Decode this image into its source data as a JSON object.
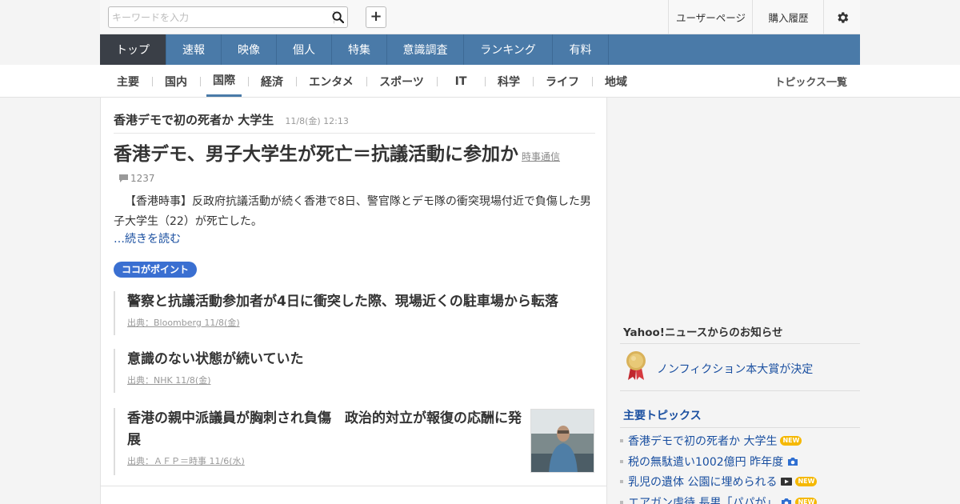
{
  "header": {
    "search_placeholder": "キーワードを入力",
    "user_page": "ユーザーページ",
    "purchase_history": "購入履歴",
    "add_label": "+"
  },
  "main_nav": [
    "トップ",
    "速報",
    "映像",
    "個人",
    "特集",
    "意識調査",
    "ランキング",
    "有料"
  ],
  "sub_nav": {
    "items": [
      "主要",
      "国内",
      "国際",
      "経済",
      "エンタメ",
      "スポーツ",
      "IT",
      "科学",
      "ライフ",
      "地域"
    ],
    "active": "国際",
    "topics_all": "トピックス一覧"
  },
  "article": {
    "headline": "香港デモで初の死者か 大学生",
    "headline_date": "11/8(金) 12:13",
    "title": "香港デモ、男子大学生が死亡＝抗議活動に参加か",
    "source": "時事通信",
    "comment_count": "1237",
    "summary": "【香港時事】反政府抗議活動が続く香港で8日、警官隊とデモ隊の衝突現場付近で負傷した男子大学生（22）が死亡した。",
    "read_more": "…続きを読む",
    "point_badge": "ココがポイント",
    "points": [
      {
        "title": "警察と抗議活動参加者が4日に衝突した際、現場近くの駐車場から転落",
        "meta": "出典：Bloomberg 11/8(金)"
      },
      {
        "title": "意識のない状態が続いていた",
        "meta": "出典：NHK 11/8(金)"
      },
      {
        "title": "香港の親中派議員が胸刺され負傷　政治的対立が報復の応酬に発展",
        "meta": "出典：ＡＦＰ＝時事 11/6(水)"
      }
    ]
  },
  "sidebar": {
    "notice_title": "Yahoo!ニュースからのお知らせ",
    "notice_link": "ノンフィクション本大賞が決定",
    "topics_title": "主要トピックス",
    "new_label": "NEW",
    "topics": [
      {
        "text": "香港デモで初の死者か 大学生",
        "icon": "",
        "new": true
      },
      {
        "text": "税の無駄遣い1002億円 昨年度",
        "icon": "camera-icon",
        "new": false
      },
      {
        "text": "乳児の遺体 公園に埋められる",
        "icon": "video-icon",
        "new": true
      },
      {
        "text": "エアガン虐待 長男「パパが」",
        "icon": "camera-icon",
        "new": true
      }
    ]
  },
  "colors": {
    "nav": "#4a7aa8",
    "nav_top_active": "#3a3f47",
    "link": "#1a4fa0",
    "badge": "#3a6fd1",
    "new_badge": "#f5b800"
  }
}
